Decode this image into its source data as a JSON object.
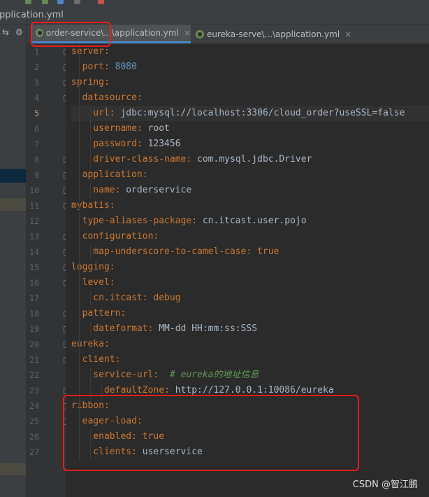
{
  "window": {
    "file_name": "pplication.yml"
  },
  "tabs": [
    {
      "label": "order-service\\...\\application.yml",
      "close": "×",
      "active": true
    },
    {
      "label": "eureka-serve\\...\\application.yml",
      "close": "×",
      "active": false
    }
  ],
  "project_tools": {
    "left": "⇆",
    "right": "⚙"
  },
  "current_line": 5,
  "lines": [
    {
      "n": "1",
      "tokens": [
        {
          "t": "server",
          "c": "k"
        },
        {
          "t": ":",
          "c": "p"
        }
      ]
    },
    {
      "n": "2",
      "tokens": [
        {
          "t": "  port",
          "c": "k"
        },
        {
          "t": ": ",
          "c": "p"
        },
        {
          "t": "8080",
          "c": "n"
        }
      ]
    },
    {
      "n": "3",
      "tokens": [
        {
          "t": "spring",
          "c": "k"
        },
        {
          "t": ":",
          "c": "p"
        }
      ]
    },
    {
      "n": "4",
      "tokens": [
        {
          "t": "  datasource",
          "c": "k"
        },
        {
          "t": ":",
          "c": "p"
        }
      ]
    },
    {
      "n": "5",
      "tokens": [
        {
          "t": "    url",
          "c": "k"
        },
        {
          "t": ": ",
          "c": "p"
        },
        {
          "t": "jdbc:mysql://localhost:3306/cloud_order?useSSL=false",
          "c": "v"
        }
      ]
    },
    {
      "n": "6",
      "tokens": [
        {
          "t": "    username",
          "c": "k"
        },
        {
          "t": ": ",
          "c": "p"
        },
        {
          "t": "root",
          "c": "v"
        }
      ]
    },
    {
      "n": "7",
      "tokens": [
        {
          "t": "    password",
          "c": "k"
        },
        {
          "t": ": ",
          "c": "p"
        },
        {
          "t": "123456",
          "c": "v"
        }
      ]
    },
    {
      "n": "8",
      "tokens": [
        {
          "t": "    driver-class-name",
          "c": "k"
        },
        {
          "t": ": ",
          "c": "p"
        },
        {
          "t": "com.mysql.jdbc.Driver",
          "c": "v"
        }
      ]
    },
    {
      "n": "9",
      "tokens": [
        {
          "t": "  application",
          "c": "k"
        },
        {
          "t": ":",
          "c": "p"
        }
      ]
    },
    {
      "n": "10",
      "tokens": [
        {
          "t": "    name",
          "c": "k"
        },
        {
          "t": ": ",
          "c": "p"
        },
        {
          "t": "orderservice",
          "c": "v"
        }
      ]
    },
    {
      "n": "11",
      "tokens": [
        {
          "t": "mybatis",
          "c": "k"
        },
        {
          "t": ":",
          "c": "p"
        }
      ]
    },
    {
      "n": "12",
      "tokens": [
        {
          "t": "  type-aliases-package",
          "c": "k"
        },
        {
          "t": ": ",
          "c": "p"
        },
        {
          "t": "cn.itcast.user.pojo",
          "c": "v"
        }
      ]
    },
    {
      "n": "13",
      "tokens": [
        {
          "t": "  configuration",
          "c": "k"
        },
        {
          "t": ":",
          "c": "p"
        }
      ]
    },
    {
      "n": "14",
      "tokens": [
        {
          "t": "    map-underscore-to-camel-case",
          "c": "k"
        },
        {
          "t": ": ",
          "c": "p"
        },
        {
          "t": "true",
          "c": "k"
        }
      ]
    },
    {
      "n": "15",
      "tokens": [
        {
          "t": "logging",
          "c": "k"
        },
        {
          "t": ":",
          "c": "p"
        }
      ]
    },
    {
      "n": "16",
      "tokens": [
        {
          "t": "  level",
          "c": "k"
        },
        {
          "t": ":",
          "c": "p"
        }
      ]
    },
    {
      "n": "17",
      "tokens": [
        {
          "t": "    cn.itcast",
          "c": "k"
        },
        {
          "t": ": ",
          "c": "p"
        },
        {
          "t": "debug",
          "c": "k"
        }
      ]
    },
    {
      "n": "18",
      "tokens": [
        {
          "t": "  pattern",
          "c": "k"
        },
        {
          "t": ":",
          "c": "p"
        }
      ]
    },
    {
      "n": "19",
      "tokens": [
        {
          "t": "    dateformat",
          "c": "k"
        },
        {
          "t": ": ",
          "c": "p"
        },
        {
          "t": "MM-dd HH:mm:ss:SSS",
          "c": "v"
        }
      ]
    },
    {
      "n": "20",
      "tokens": [
        {
          "t": "eureka",
          "c": "k"
        },
        {
          "t": ":",
          "c": "p"
        }
      ]
    },
    {
      "n": "21",
      "tokens": [
        {
          "t": "  client",
          "c": "k"
        },
        {
          "t": ":",
          "c": "p"
        }
      ]
    },
    {
      "n": "22",
      "tokens": [
        {
          "t": "    service-url",
          "c": "k"
        },
        {
          "t": ":  ",
          "c": "p"
        },
        {
          "t": "# eureka的地址信息",
          "c": "cmt"
        }
      ]
    },
    {
      "n": "23",
      "tokens": [
        {
          "t": "      defaultZone",
          "c": "k"
        },
        {
          "t": ": ",
          "c": "p"
        },
        {
          "t": "http://127.0.0.1:10086/eureka",
          "c": "v"
        }
      ]
    },
    {
      "n": "24",
      "tokens": [
        {
          "t": "ribbon",
          "c": "k"
        },
        {
          "t": ":",
          "c": "p"
        }
      ]
    },
    {
      "n": "25",
      "tokens": [
        {
          "t": "  eager-load",
          "c": "k"
        },
        {
          "t": ":",
          "c": "p"
        }
      ]
    },
    {
      "n": "26",
      "tokens": [
        {
          "t": "    enabled",
          "c": "k"
        },
        {
          "t": ": ",
          "c": "p"
        },
        {
          "t": "true",
          "c": "k"
        }
      ]
    },
    {
      "n": "27",
      "tokens": [
        {
          "t": "    clients",
          "c": "k"
        },
        {
          "t": ": ",
          "c": "p"
        },
        {
          "t": "userservice",
          "c": "v"
        }
      ]
    }
  ],
  "watermark": "CSDN @智江鹏"
}
